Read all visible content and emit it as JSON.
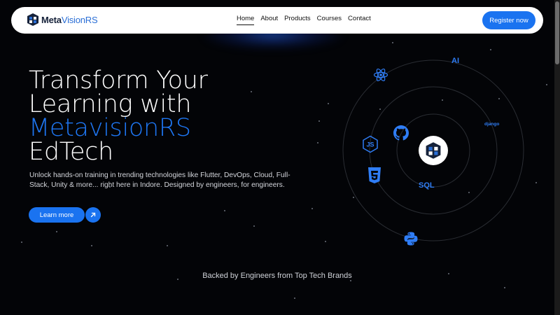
{
  "brand": {
    "name_bold": "Meta",
    "name_rest": "VisionRS"
  },
  "nav": {
    "links": [
      {
        "label": "Home",
        "active": true
      },
      {
        "label": "About"
      },
      {
        "label": "Products"
      },
      {
        "label": "Courses"
      },
      {
        "label": "Contact"
      }
    ],
    "register_label": "Register now"
  },
  "hero": {
    "title_line1": "Transform Your",
    "title_line2": "Learning with",
    "title_accent": "MetavisionRS",
    "title_line4": "EdTech",
    "subtitle": "Unlock hands-on training in trending technologies like Flutter, DevOps, Cloud, Full-Stack, Unity & more... right here in Indore. Designed by engineers, for engineers.",
    "cta_label": "Learn more",
    "cta_icon": "arrow-up-right-icon"
  },
  "orbit": {
    "center": "metavisionrs-logo",
    "labels": {
      "ai": "AI",
      "sql": "SQL",
      "django": "django"
    },
    "icons": [
      "react-icon",
      "github-icon",
      "nodejs-icon",
      "html5-icon",
      "python-icon"
    ]
  },
  "backed_text": "Backed by Engineers from Top Tech Brands",
  "colors": {
    "accent": "#1a73f0",
    "background": "#030407",
    "navbar": "#ffffff"
  }
}
